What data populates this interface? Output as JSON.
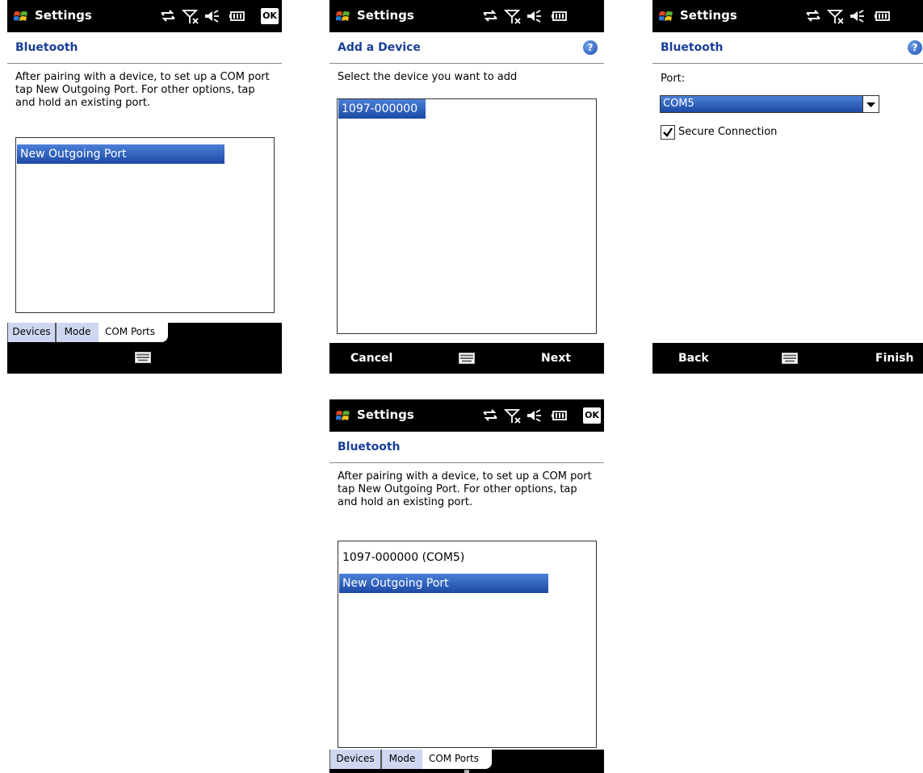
{
  "common": {
    "app_title": "Settings",
    "ok_label": "OK"
  },
  "screen1": {
    "subtitle": "Bluetooth",
    "instructions": "After pairing with a device, to set up a COM port tap New Outgoing Port. For other options, tap and hold an existing port.",
    "list_items": [
      "New Outgoing Port"
    ],
    "tabs": [
      "Devices",
      "Mode",
      "COM Ports"
    ],
    "active_tab": "COM Ports"
  },
  "screen2": {
    "subtitle": "Add a Device",
    "instructions": "Select the device you want to add",
    "list_items": [
      "1097-000000"
    ],
    "softkeys": {
      "left": "Cancel",
      "right": "Next"
    }
  },
  "screen3": {
    "subtitle": "Bluetooth",
    "port_label": "Port:",
    "port_value": "COM5",
    "secure_label": "Secure Connection",
    "secure_checked": true,
    "softkeys": {
      "left": "Back",
      "right": "Finish"
    }
  },
  "screen4": {
    "subtitle": "Bluetooth",
    "instructions": "After pairing with a device, to set up a COM port tap New Outgoing Port. For other options, tap and hold an existing port.",
    "list_items": [
      "1097-000000 (COM5)",
      "New Outgoing Port"
    ],
    "tabs": [
      "Devices",
      "Mode",
      "COM Ports"
    ],
    "active_tab": "COM Ports"
  },
  "icons": [
    "windows-flag-icon",
    "sync-arrows-icon",
    "no-signal-icon",
    "speaker-muted-icon",
    "battery-icon",
    "help-icon",
    "keyboard-icon",
    "dropdown-arrow-icon",
    "checkmark-icon"
  ],
  "colors": {
    "titlebar_bg": "#000000",
    "subtitle_blue": "#1a3f97",
    "selection_blue": "#2a5ab8",
    "tab_inactive": "#cfd6f0"
  }
}
